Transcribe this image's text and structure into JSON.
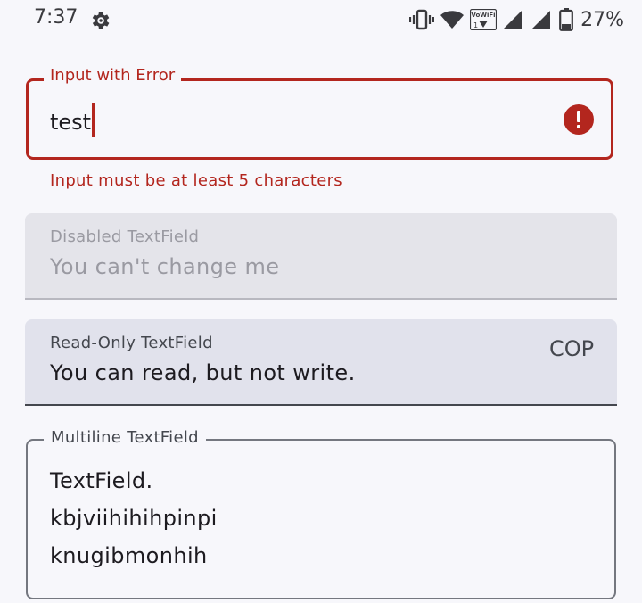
{
  "status_bar": {
    "time": "7:37",
    "battery_percent": "27%",
    "wifi_calling_top": "VoWiFi",
    "wifi_calling_bottom": "1",
    "icons": [
      "gear-icon",
      "vibrate-icon",
      "wifi-icon",
      "vowifi-icon",
      "signal-icon",
      "signal-icon",
      "battery-icon"
    ]
  },
  "error_field": {
    "label": "Input with Error",
    "value": "test",
    "supporting_text": "Input must be at least 5 characters",
    "error_color": "#b3261e"
  },
  "disabled_field": {
    "label": "Disabled TextField",
    "value": "You can't change me"
  },
  "readonly_field": {
    "label": "Read-Only TextField",
    "value": "You can read, but not write.",
    "trailing_text": "COP\n,"
  },
  "multiline_field": {
    "label": "Multiline TextField",
    "lines": [
      "TextField.",
      "kbjviihihihpinpi",
      "knugibmonhih"
    ]
  }
}
